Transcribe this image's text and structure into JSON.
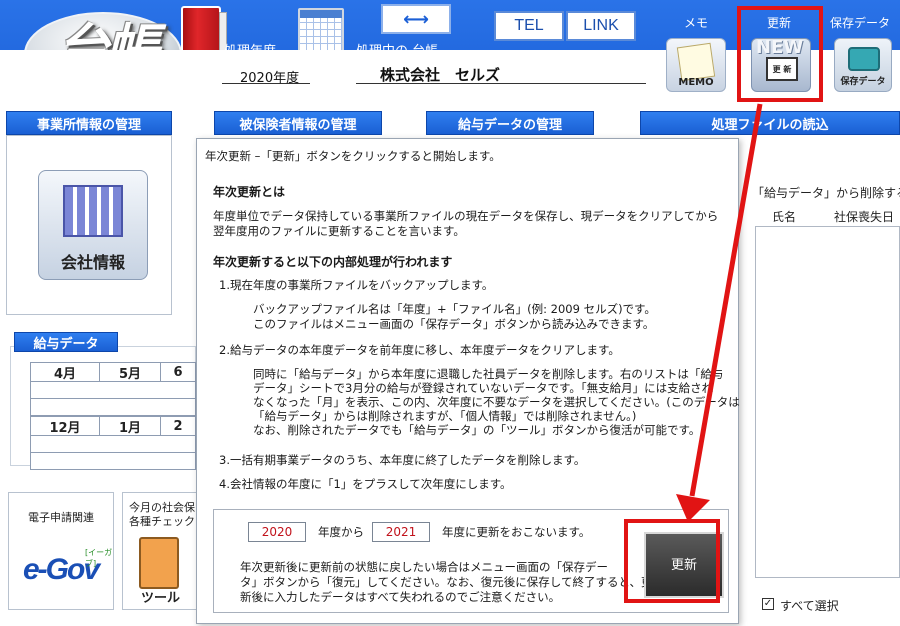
{
  "header": {
    "logo": "台帳",
    "year_label": "処理年度",
    "ledger_label": "処理中の 台帳",
    "year_value": "2020年度",
    "company_name": "株式会社　セルズ",
    "tel_label": "TEL",
    "link_label": "LINK",
    "memo_label": "メモ",
    "update_label": "更新",
    "save_data_label": "保存データ",
    "memo_tile": "MEMO",
    "new_tile": "NEW",
    "new_screen": "更 新",
    "save_tile": "保存データ"
  },
  "sections": {
    "office": "事業所情報の管理",
    "insured": "被保険者情報の管理",
    "salary": "給与データの管理",
    "file_load": "処理ファイルの読込"
  },
  "left": {
    "company_info": "会社情報",
    "salary_data": "給与データ",
    "months_row1": [
      "4月",
      "5月",
      "6"
    ],
    "months_row2": [
      "12月",
      "1月",
      "2"
    ],
    "e_filing": "電子申請関連",
    "egov_logo": "e-Gov",
    "egov_sub": "[イーガブ]",
    "monthly_line1": "今月の社会保",
    "monthly_line2": "各種チェック",
    "tool_text": "ツール"
  },
  "right": {
    "removed_heading": "「給与データ」から削除する",
    "col_name": "氏名",
    "col_loss_date": "社保喪失日",
    "select_all": "すべて選択"
  },
  "modal": {
    "instruction": "年次更新 –「更新」ボタンをクリックすると開始します。",
    "what_heading": "年次更新とは",
    "what_line1": "年度単位でデータ保持している事業所ファイルの現在データを保存し、現データをクリアしてから",
    "what_line2": "翌年度用のファイルに更新することを言います。",
    "process_heading": "年次更新すると以下の内部処理が行われます",
    "step1": "1.現在年度の事業所ファイルをバックアップします。",
    "step1_line1": "バックアップファイル名は「年度」+「ファイル名」(例: 2009 セルズ)です。",
    "step1_line2": "このファイルはメニュー画面の「保存データ」ボタンから読み込みできます。",
    "step2": "2.給与データの本年度データを前年度に移し、本年度データをクリアします。",
    "step2_line1": "同時に「給与データ」から本年度に退職した社員データを削除します。右のリストは「給与",
    "step2_line2": "データ」シートで3月分の給与が登録されていないデータです。「無支給月」には支給され",
    "step2_line3": "なくなった「月」を表示、この内、次年度に不要なデータを選択してください。(このデータは",
    "step2_line4": "「給与データ」からは削除されますが、「個人情報」では削除されません。)",
    "step2_line5": "なお、削除されたデータでも「給与データ」の「ツール」ボタンから復活が可能です。",
    "step3": "3.一括有期事業データのうち、本年度に終了したデータを削除します。",
    "step4": "4.会社情報の年度に「1」をプラスして次年度にします。",
    "from_year": "2020",
    "from_label": "年度から",
    "to_year": "2021",
    "to_label": "年度に更新をおこないます。",
    "note_line1": "年次更新後に更新前の状態に戻したい場合はメニュー画面の「保存デー",
    "note_line2": "タ」ボタンから「復元」してください。なお、復元後に保存して終了すると、更",
    "note_line3": "新後に入力したデータはすべて失われるのでご注意ください。",
    "update_button": "更新"
  },
  "colors": {
    "header_blue": "#1b5fd6",
    "highlight_red": "#e11414",
    "year_red": "#c1121b"
  }
}
